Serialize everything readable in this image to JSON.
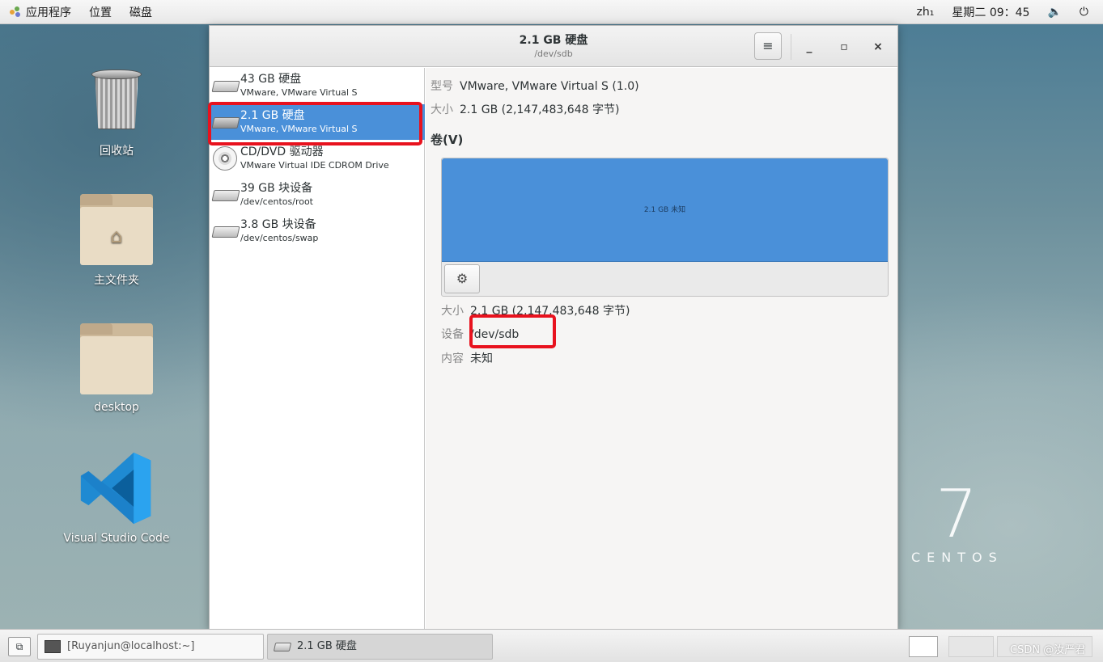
{
  "top_panel": {
    "applications": "应用程序",
    "places": "位置",
    "disks": "磁盘",
    "input_method": "zh₁",
    "clock": "星期二 09：45"
  },
  "desktop": {
    "icons": [
      {
        "label": "回收站",
        "icon": "trash-icon"
      },
      {
        "label": "主文件夹",
        "icon": "home-folder-icon"
      },
      {
        "label": "desktop",
        "icon": "folder-icon"
      },
      {
        "label": "Visual Studio Code",
        "icon": "vscode-icon"
      }
    ],
    "branding": {
      "number": "7",
      "word": "CENTOS"
    }
  },
  "window": {
    "title": "2.1 GB 硬盘",
    "subtitle": "/dev/sdb",
    "drives": [
      {
        "title": "43 GB 硬盘",
        "subtitle": "VMware, VMware Virtual S",
        "icon": "hard-disk-icon",
        "selected": false
      },
      {
        "title": "2.1 GB 硬盘",
        "subtitle": "VMware, VMware Virtual S",
        "icon": "hard-disk-icon",
        "selected": true
      },
      {
        "title": "CD/DVD 驱动器",
        "subtitle": "VMware Virtual IDE CDROM Drive",
        "icon": "optical-disc-icon",
        "selected": false
      },
      {
        "title": "39 GB 块设备",
        "subtitle": "/dev/centos/root",
        "icon": "block-device-icon",
        "selected": false
      },
      {
        "title": "3.8 GB 块设备",
        "subtitle": "/dev/centos/swap",
        "icon": "block-device-icon",
        "selected": false
      }
    ],
    "details": {
      "model_label": "型号",
      "model_value": "VMware, VMware Virtual S (1.0)",
      "size_label": "大小",
      "size_value": "2.1 GB (2,147,483,648 字节)",
      "volumes_heading": "卷(V)",
      "partition_label": "2.1 GB 未知",
      "vol_size_label": "大小",
      "vol_size_value": "2.1 GB (2,147,483,648 字节)",
      "device_label": "设备",
      "device_value": "/dev/sdb",
      "contents_label": "内容",
      "contents_value": "未知"
    }
  },
  "taskbar": {
    "tasks": [
      {
        "label": "[Ruyanjun@localhost:~]",
        "icon": "terminal-icon",
        "active": false
      },
      {
        "label": "2.1 GB 硬盘",
        "icon": "disks-app-icon",
        "active": true
      }
    ],
    "watermark": "CSDN @汝严君"
  },
  "colors": {
    "selection": "#4a90d9",
    "highlight_box": "#e8121e"
  }
}
